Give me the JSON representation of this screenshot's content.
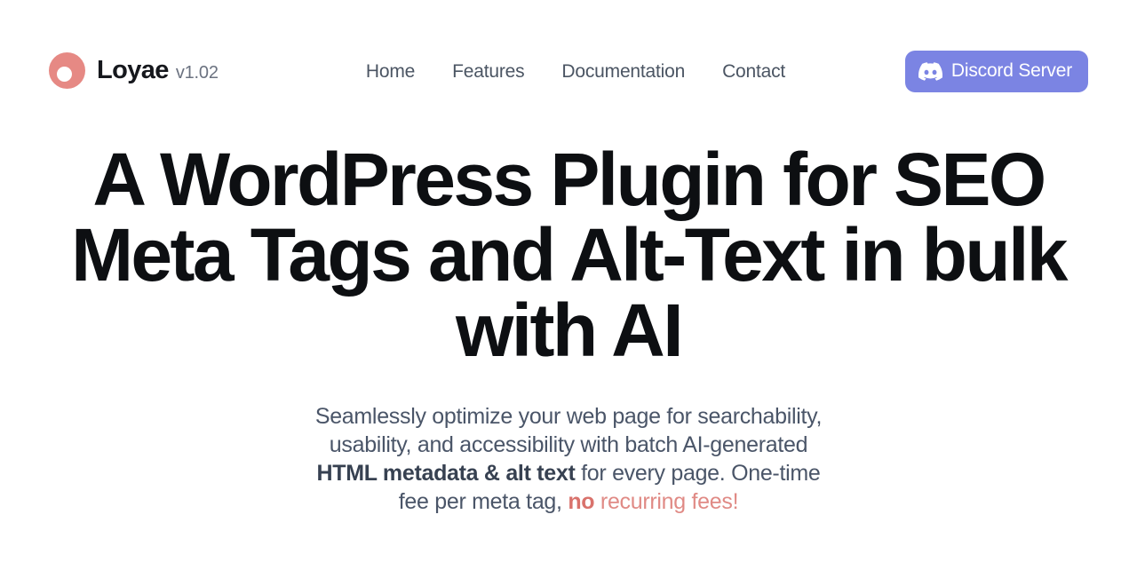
{
  "theme": {
    "background": "#ffffff",
    "brand_coral": "#E68984",
    "accent_coral": "#E08A85",
    "accent_coral_strong": "#D9726C",
    "discord_blurple": "#7B84E3",
    "heading_color": "#0d0f12",
    "body_color": "#4a5568",
    "body_strong_color": "#374151",
    "nav_color": "#4b5563"
  },
  "header": {
    "brand": {
      "logo_icon": "coral-donut-logo",
      "name": "Loyae",
      "version": "v1.02"
    },
    "nav": [
      {
        "label": "Home"
      },
      {
        "label": "Features"
      },
      {
        "label": "Documentation"
      },
      {
        "label": "Contact"
      }
    ],
    "cta": {
      "label": "Discord Server",
      "icon": "discord-icon"
    }
  },
  "hero": {
    "title_lines": [
      "A WordPress Plugin for SEO",
      "Meta Tags and Alt-Text in bulk",
      "with AI"
    ],
    "subtitle": {
      "part1": "Seamlessly optimize your web page for searchability, usability, and accessibility with batch AI-generated ",
      "strong1": "HTML metadata & alt text",
      "part2": " for every page. One-time fee per meta tag, ",
      "accent_strong": "no",
      "accent": " recurring fees!"
    }
  }
}
